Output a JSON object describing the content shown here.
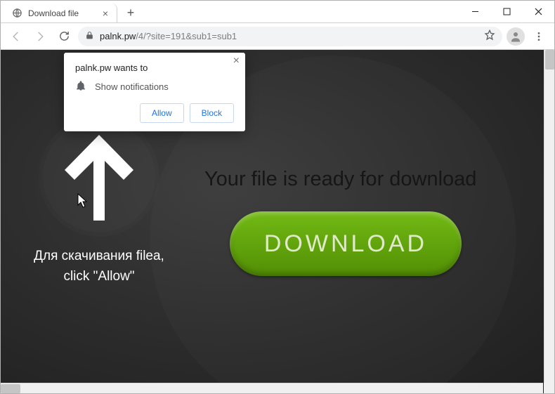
{
  "window": {
    "tab_title": "Download file",
    "url_host": "palnk.pw",
    "url_path": "/4/?site=191&sub1=sub1"
  },
  "notification": {
    "origin_wants": "palnk.pw wants to",
    "permission_label": "Show notifications",
    "allow_label": "Allow",
    "block_label": "Block"
  },
  "page": {
    "instruction_line1": "Для скачивания filea,",
    "instruction_line2": "click \"Allow\"",
    "headline": "Your file is ready for download",
    "download_button_label": "DOWNLOAD"
  },
  "icons": {
    "globe": "globe-icon",
    "bell": "bell-icon",
    "lock": "lock-icon",
    "star": "star-icon",
    "user": "user-icon"
  }
}
